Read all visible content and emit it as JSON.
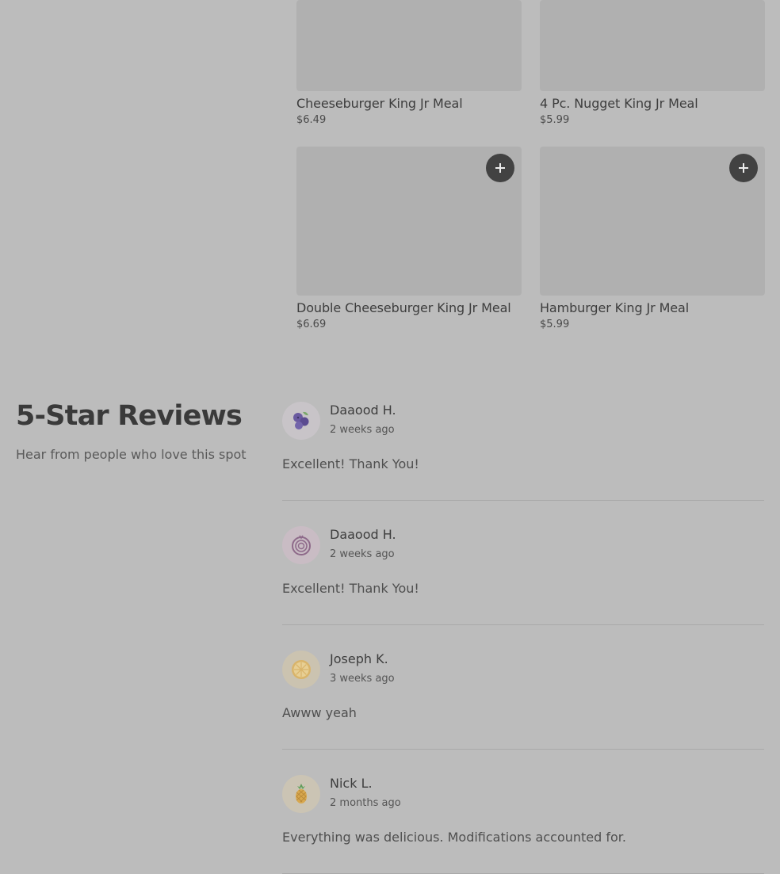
{
  "menu_items": [
    {
      "name": "Cheeseburger King Jr Meal",
      "price": "$6.49"
    },
    {
      "name": "4 Pc. Nugget King Jr Meal",
      "price": "$5.99"
    },
    {
      "name": "Double Cheeseburger King Jr Meal",
      "price": "$6.69"
    },
    {
      "name": "Hamburger King Jr Meal",
      "price": "$5.99"
    }
  ],
  "add_button_icon": "plus-icon",
  "reviews_section": {
    "title": "5-Star Reviews",
    "subtitle": "Hear from people who love this spot"
  },
  "reviews": [
    {
      "author": "Daaood H.",
      "time": "2 weeks ago",
      "text": "Excellent! Thank You!",
      "avatar_icon": "blueberry-icon"
    },
    {
      "author": "Daaood H.",
      "time": "2 weeks ago",
      "text": "Excellent! Thank You!",
      "avatar_icon": "onion-icon"
    },
    {
      "author": "Joseph K.",
      "time": "3 weeks ago",
      "text": "Awww yeah",
      "avatar_icon": "lemon-slice-icon"
    },
    {
      "author": "Nick L.",
      "time": "2 months ago",
      "text": "Everything was delicious. Modifications accounted for.",
      "avatar_icon": "pineapple-icon"
    }
  ]
}
